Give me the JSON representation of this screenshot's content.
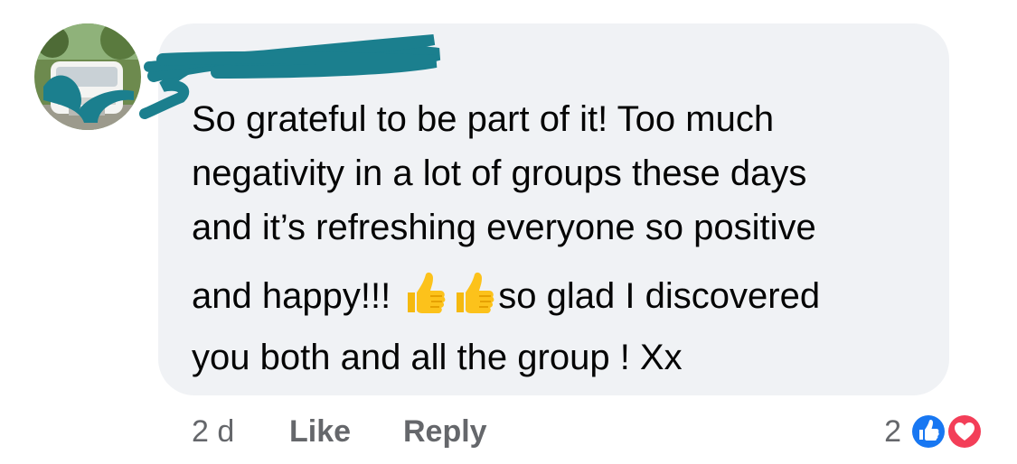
{
  "comment": {
    "author": "",
    "lines": [
      "So grateful to be part of it! Too much",
      "negativity in a lot of groups these days",
      "and it’s refreshing everyone so positive",
      "and happy!!! ",
      "so glad I discovered",
      "you both and all the group ! Xx"
    ],
    "emojis": [
      "thumbs-up",
      "thumbs-up"
    ]
  },
  "actions": {
    "time": "2 d",
    "like_label": "Like",
    "reply_label": "Reply"
  },
  "reactions": {
    "count": "2",
    "types": [
      "like",
      "love"
    ]
  },
  "colors": {
    "bubble": "#f0f2f5",
    "text": "#050505",
    "meta": "#65676b",
    "like_blue": "#1877f2",
    "love_red": "#f33e58",
    "redaction": "#1b7f8e"
  }
}
